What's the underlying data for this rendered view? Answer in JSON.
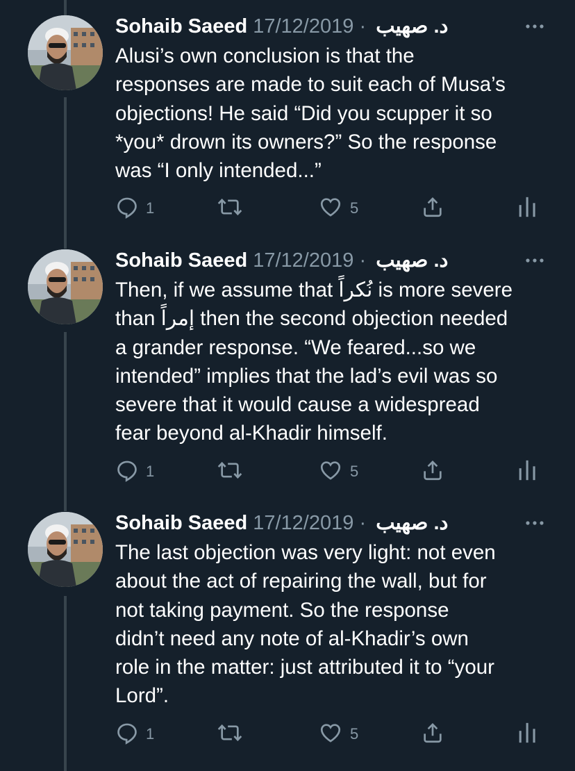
{
  "tweets": [
    {
      "author": "Sohaib Saeed",
      "author_arabic": "د. صهيب",
      "separator": "·",
      "date": "17/12/2019",
      "lines": [
        "Alusi’s own conclusion is that the",
        "responses are made to suit each of Musa’s",
        "objections! He said “Did you scupper it so",
        "*you* drown its owners?” So the response",
        "was “I only intended...”"
      ],
      "replies": "1",
      "likes": "5"
    },
    {
      "author": "Sohaib Saeed",
      "author_arabic": "د. صهيب",
      "separator": "·",
      "date": "17/12/2019",
      "lines": [
        "Then, if we assume that نُكراً is more severe",
        "than إمراً then the second objection needed",
        "a grander response. “We feared...so we",
        "intended” implies that the lad’s evil was so",
        "severe that it would cause a widespread",
        "fear beyond al-Khadir himself."
      ],
      "replies": "1",
      "likes": "5"
    },
    {
      "author": "Sohaib Saeed",
      "author_arabic": "د. صهيب",
      "separator": "·",
      "date": "17/12/2019",
      "lines": [
        "The last objection was very light: not even",
        "about the act of repairing the wall, but for",
        "not taking payment. So the response",
        "didn’t need any note of al-Khadir’s own",
        "role in the matter: just attributed it to “your",
        "Lord”."
      ],
      "replies": "1",
      "likes": "5"
    }
  ],
  "icons": {
    "more": "more-icon",
    "reply": "reply-icon",
    "retweet": "retweet-icon",
    "like": "like-icon",
    "share": "share-icon",
    "analytics": "analytics-icon"
  },
  "colors": {
    "background": "#15202b",
    "text": "#ffffff",
    "secondary": "#8899a6",
    "thread_line": "#38444d"
  }
}
